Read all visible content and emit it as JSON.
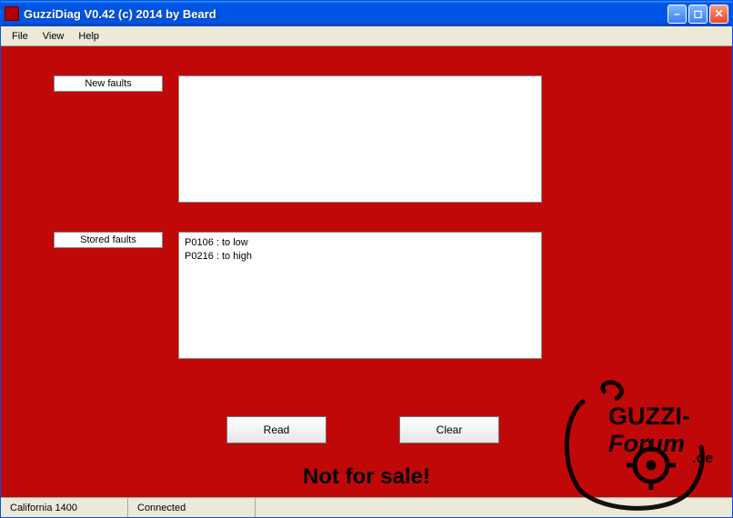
{
  "window": {
    "title": "GuzziDiag V0.42  (c) 2014 by Beard"
  },
  "menu": {
    "file": "File",
    "view": "View",
    "help": "Help"
  },
  "labels": {
    "new_faults": "New faults",
    "stored_faults": "Stored faults"
  },
  "faults": {
    "new": "",
    "stored": "P0106 : to low\nP0216 : to high"
  },
  "buttons": {
    "read": "Read",
    "clear": "Clear"
  },
  "banner": "Not for sale!",
  "status": {
    "model": "California 1400",
    "connection": "Connected"
  },
  "watermark": {
    "line1": "GUZZI-",
    "line2": "Forum",
    "line3": ".de"
  }
}
